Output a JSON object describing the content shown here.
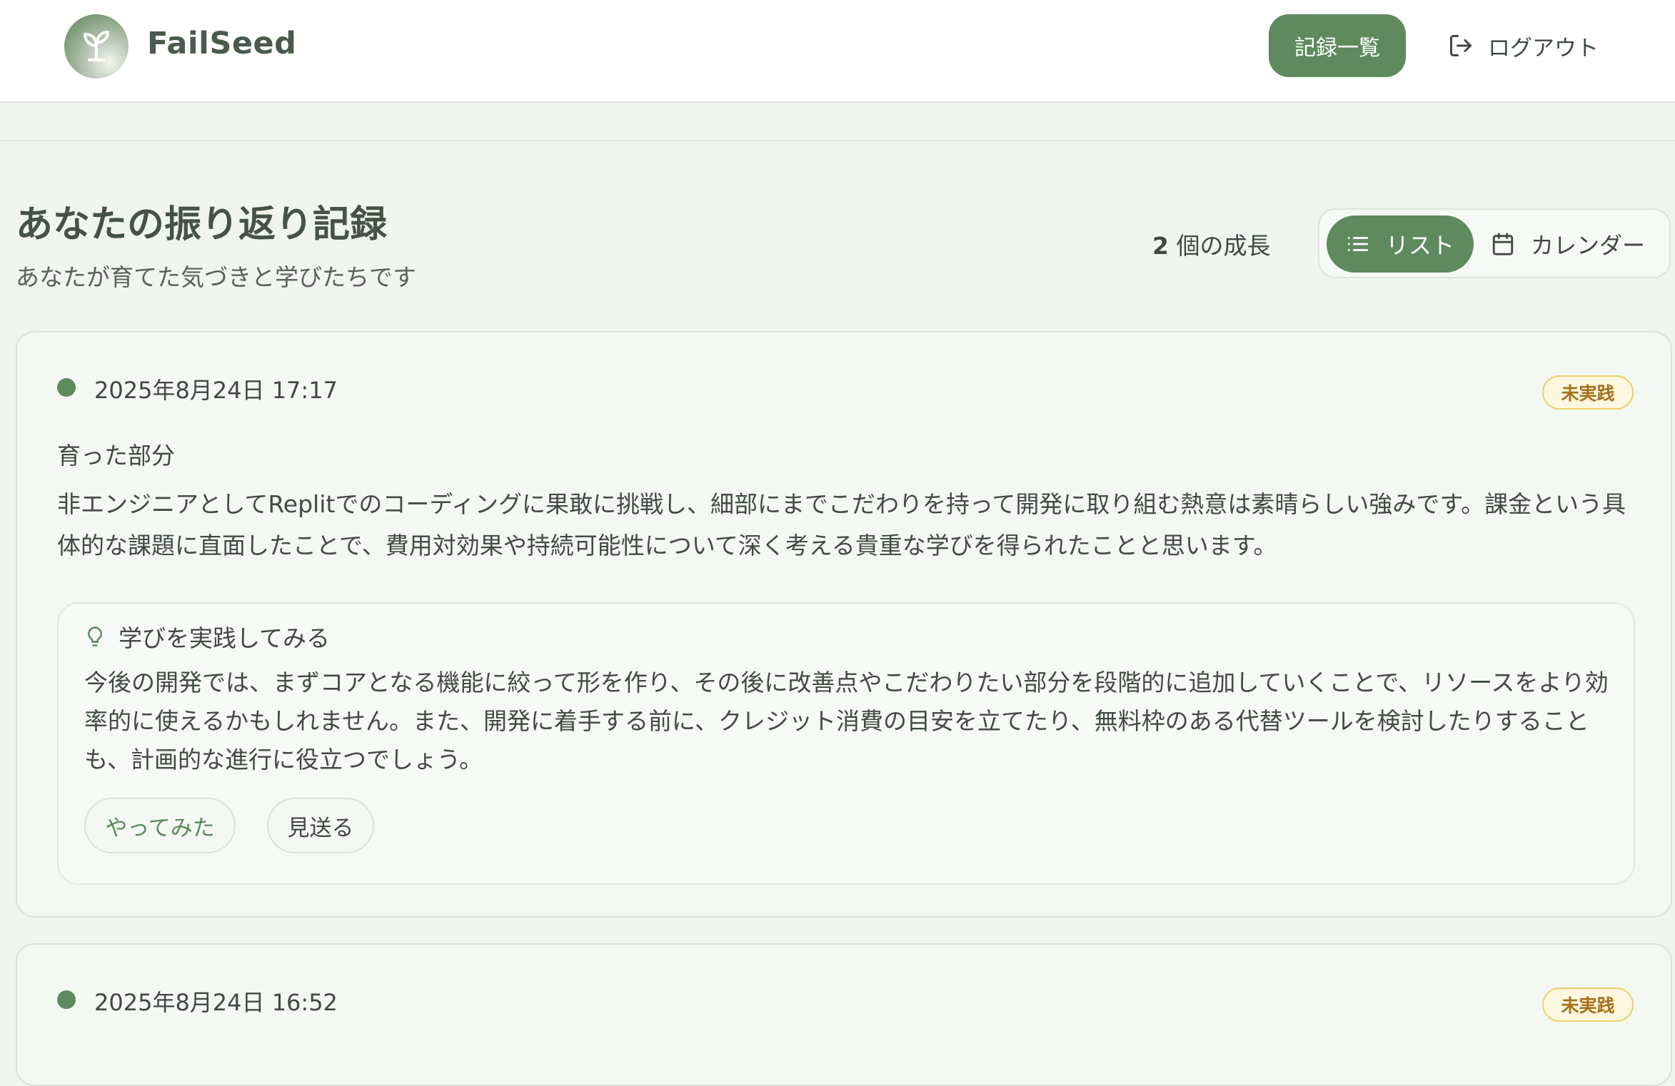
{
  "header": {
    "brand": "FailSeed",
    "nav_records": "記録一覧",
    "logout": "ログアウト"
  },
  "page": {
    "title": "あなたの振り返り記録",
    "subtitle": "あなたが育てた気づきと学びたちです",
    "count_number": "2",
    "count_suffix": " 個の成長",
    "view_list": "リスト",
    "view_calendar": "カレンダー"
  },
  "entries": [
    {
      "date": "2025年8月24日 17:17",
      "status": "未実践",
      "section_label": "育った部分",
      "growth_text": "非エンジニアとしてReplitでのコーディングに果敢に挑戦し、細部にまでこだわりを持って開発に取り組む熱意は素晴らしい強みです。課金という具体的な課題に直面したことで、費用対効果や持続可能性について深く考える貴重な学びを得られたことと思います。",
      "practice_heading": "学びを実践してみる",
      "practice_text": "今後の開発では、まずコアとなる機能に絞って形を作り、その後に改善点やこだわりたい部分を段階的に追加していくことで、リソースをより効率的に使えるかもしれません。また、開発に着手する前に、クレジット消費の目安を立てたり、無料枠のある代替ツールを検討したりすることも、計画的な進行に役立つでしょう。",
      "btn_tried": "やってみた",
      "btn_skip": "見送る"
    },
    {
      "date": "2025年8月24日 16:52",
      "status": "未実践"
    }
  ],
  "colors": {
    "accent": "#5e8a5e",
    "background": "#f0f5ef",
    "badge_text": "#a6701a",
    "badge_border": "#f0cf6a"
  },
  "icons": {
    "logo": "sprout-icon",
    "logout": "logout-icon",
    "list": "list-icon",
    "calendar": "calendar-icon",
    "practice": "lightbulb-icon"
  }
}
